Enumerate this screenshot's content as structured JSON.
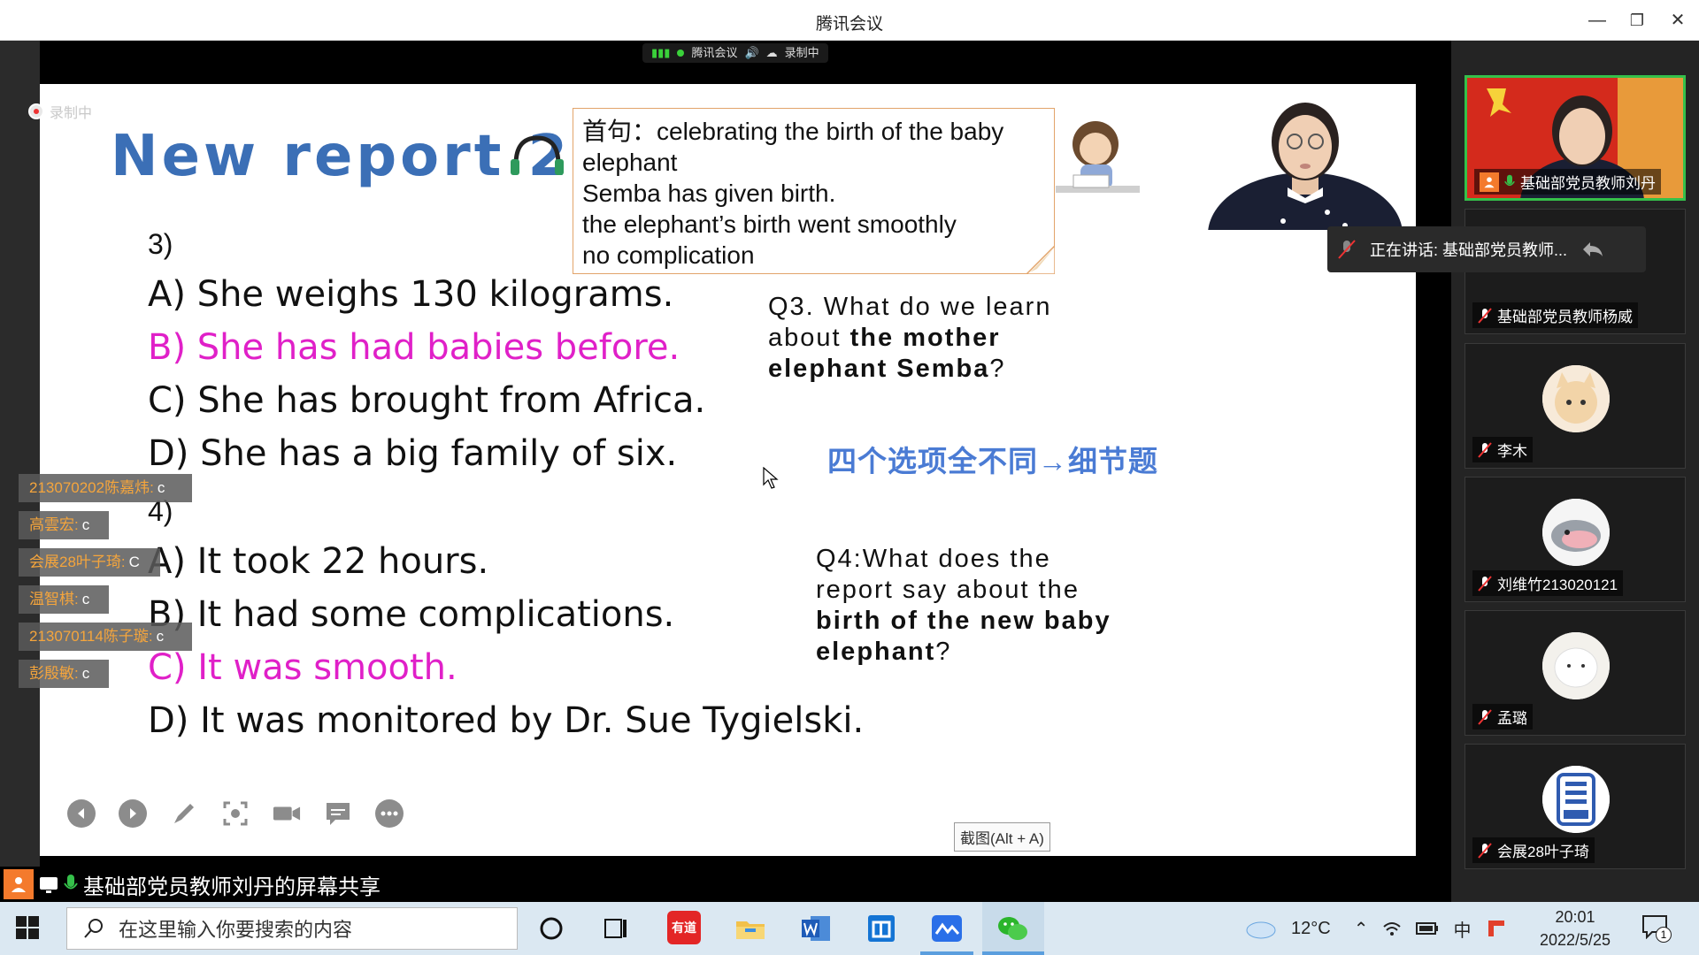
{
  "window": {
    "title": "腾讯会议"
  },
  "meeting_status": {
    "app": "腾讯会议",
    "recording": "录制中"
  },
  "recording_label": "录制中",
  "slide": {
    "title": "New report 2",
    "q3_num": "3)",
    "q3_options": [
      {
        "text": "A) She weighs 130 kilograms.",
        "highlight": false
      },
      {
        "text": "B) She has had babies before.",
        "highlight": true
      },
      {
        "text": "C) She has brought from Africa.",
        "highlight": false
      },
      {
        "text": "D) She has a big family of six.",
        "highlight": false
      }
    ],
    "q4_num": "4)",
    "q4_options": [
      {
        "text": "A) It took 22 hours.",
        "highlight": false
      },
      {
        "text": "B) It had some complications.",
        "highlight": false
      },
      {
        "text": "C) It was smooth.",
        "highlight": true
      },
      {
        "text": "D) It was monitored by Dr. Sue Tygielski.",
        "highlight": false
      }
    ],
    "note_lines": [
      "首句：celebrating the birth of the baby",
      "elephant",
      "Semba has given birth.",
      "the elephant’s birth went smoothly",
      "no complication"
    ],
    "q3_question": {
      "line1": "Q3. What do we learn",
      "line2_a": "about ",
      "line2_b": "the mother",
      "line3_b": "elephant Semba",
      "line3_c": "?"
    },
    "tip": "四个选项全不同→细节题",
    "q4_question": {
      "line1": "Q4:What does the",
      "line2": "report say about the",
      "line3_b": "birth of the new baby",
      "line4_b": "elephant",
      "line4_c": "?"
    }
  },
  "screenshot_tip": "截图(Alt + A)",
  "chat_messages": [
    {
      "name": "213070202陈嘉炜:",
      "msg": "c"
    },
    {
      "name": "高雲宏:",
      "msg": "c"
    },
    {
      "name": "会展28叶子琦:",
      "msg": "C"
    },
    {
      "name": "温智棋:",
      "msg": "c"
    },
    {
      "name": "213070114陈子璇:",
      "msg": "c"
    },
    {
      "name": "彭殷敏:",
      "msg": "c"
    }
  ],
  "speaking": "正在讲话: 基础部党员教师...",
  "share_bar": "基础部党员教师刘丹的屏幕共享",
  "participants": [
    {
      "name": "基础部党员教师刘丹",
      "active": true
    },
    {
      "name": "基础部党员教师杨威",
      "active": false
    },
    {
      "name": "李木",
      "active": false
    },
    {
      "name": "刘维竹213020121",
      "active": false
    },
    {
      "name": "孟璐",
      "active": false
    },
    {
      "name": "会展28叶子琦",
      "active": false
    }
  ],
  "taskbar": {
    "search_placeholder": "在这里输入你要搜索的内容",
    "weather": "12°C",
    "time": "20:01",
    "date": "2022/5/25",
    "ime": "中",
    "notification_count": "1",
    "youdao_label": "有道"
  },
  "colors": {
    "title_blue": "#3b6fb6",
    "highlight": "#e020c8",
    "active_tile": "#35c04a"
  }
}
